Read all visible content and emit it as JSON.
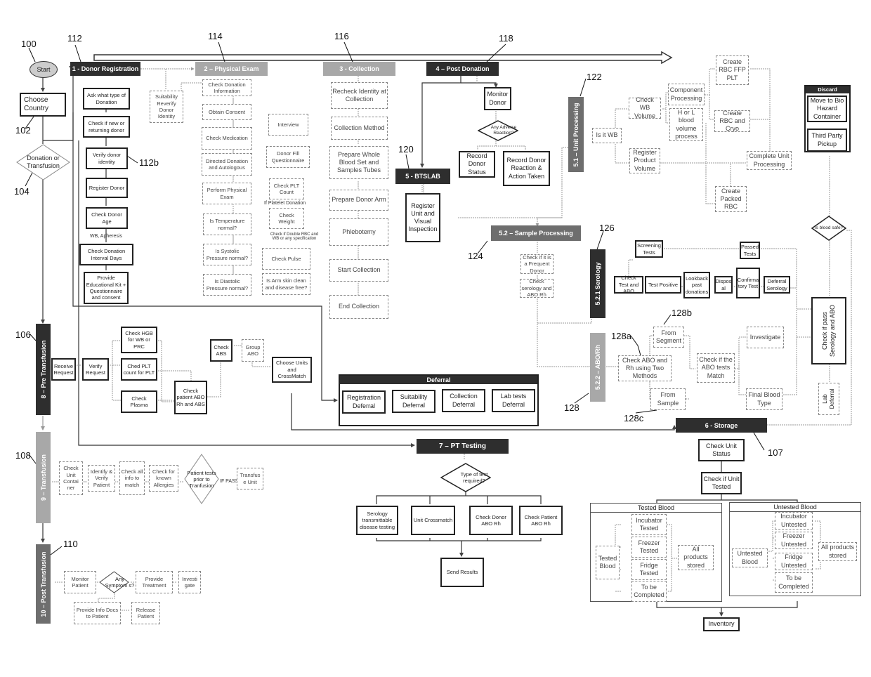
{
  "start": "Start",
  "refs": {
    "r100": "100",
    "r102": "102",
    "r104": "104",
    "r106": "106",
    "r107": "107",
    "r108": "108",
    "r110": "110",
    "r112": "112",
    "r112b": "112b",
    "r114": "114",
    "r116": "116",
    "r118": "118",
    "r120": "120",
    "r122": "122",
    "r124": "124",
    "r126": "126",
    "r128": "128",
    "r128a": "128a",
    "r128b": "128b",
    "r128c": "128c"
  },
  "entry": {
    "choose_country": "Choose Country",
    "donation_or_transfusion": "Donation or Transfusion"
  },
  "stages": {
    "s1": "1 - Donor Registration",
    "s2": "2 – Physical Exam",
    "s3": "3 - Collection",
    "s4": "4 – Post Donation",
    "s5": "5 - BTSLAB",
    "s51": "5.1 – Unit Processing",
    "s52": "5.2 – Sample Processing",
    "s521": "5.2.1 Serology",
    "s522": "5.2.2 – ABO/Rh",
    "s6": "6 - Storage",
    "s7": "7 – PT Testing",
    "s8": "8 – Pre Transfusion",
    "s9": "9 – Transfusion",
    "s10": "10 – Post Transfusion"
  },
  "registration": [
    "Ask what type of Donation",
    "Check if new or returning donor",
    "Verify donor identity",
    "Register Donor",
    "Check Donor Age",
    "Check Donation Interval Days",
    "Provide Educational Kit + Questionnaire and consent"
  ],
  "registration_label_wb": "WB, Apheresis",
  "suitability": "Suitability Reverify Donor Identity",
  "physical": [
    "Check Donation Information",
    "Obtain Consent",
    "Check Medication",
    "Directed Donation and Autologous",
    "Perform Physical Exam",
    "Is Temperature normal?",
    "Is Systolic Pressure normal?",
    "Is Diastolic Pressure normal?"
  ],
  "physical_side": [
    "Interview",
    "Donor Fill Questionnaire",
    "Check PLT Count",
    "Check Weight",
    "Check Pulse",
    "Is Arm skin clean and disease free?"
  ],
  "physical_labels": {
    "platelet": "If Platelet Donation",
    "double": "Check if Double RBC and WB or any specification"
  },
  "collection": [
    "Recheck Identity at Collection",
    "Collection Method",
    "Prepare Whole Blood Set and Samples Tubes",
    "Prepare Donor Arm",
    "Phlebotemy",
    "Start Collection",
    "End Collection"
  ],
  "post_donation": {
    "monitor": "Monitor Donor",
    "adverse": "Any Adverse Reaction?",
    "status": "Record Donor Status",
    "reaction": "Record Donor Reaction & Action Taken"
  },
  "btslab": {
    "register": "Register Unit and Visual Inspection"
  },
  "unit_processing": {
    "is_wb": "Is it WB",
    "check_wb": "Check WB Volume",
    "register_product": "Register Product Volume",
    "component": "Component Processing",
    "hl": "H or L blood volume process",
    "rbc_ffp": "Create RBC FFP PLT",
    "rbc_cryo": "Create RBC and Cryo",
    "packed": "Create Packed RBC",
    "complete": "Complete Unit Processing"
  },
  "sample_processing": {
    "frequent": "Check if it is a Frequent Donor",
    "serology_abo": "Check serology and ABO Rh"
  },
  "serology": {
    "check_test": "Check Test and ABO",
    "screening": "Screening Tests",
    "positive": "Test Positive",
    "lookback": "Lookback past donations",
    "disposal": "Dispos al",
    "confirmatory": "Confirma tory Test",
    "deferral": "Deferral Serology",
    "passed": "Passed Tests"
  },
  "abo": {
    "check_two": "Check ABO and Rh using Two Methods",
    "segment": "From Segment",
    "sample": "From Sample",
    "match": "Check if the ABO tests Match",
    "investigate": "Investigate",
    "final": "Final Blood Type"
  },
  "final_check": {
    "pass": "Check if pass Serology and ABO",
    "safe": "Is blood safe?",
    "lab_deferral": "Lab Deferral"
  },
  "discard": {
    "title": "Discard",
    "bio": "Move to Bio Hazard Container",
    "third": "Third Party Pickup"
  },
  "deferral": {
    "title": "Deferral",
    "items": [
      "Registration Deferral",
      "Suitability Deferral",
      "Collection Deferral",
      "Lab tests Deferral"
    ]
  },
  "pre_transfusion": {
    "receive": "Receive Request",
    "verify": "Verify Request",
    "hgb": "Check HGB for WB or PRC",
    "plt": "Ched PLT count for PLT",
    "plasma": "Check Plasma",
    "patient_abo": "Check patient ABO Rh and ABS",
    "abs": "Check ABS",
    "group": "Group ABO",
    "choose": "Choose Units and CrossMatch"
  },
  "transfusion": {
    "container": "Check Unit Contai ner",
    "identify": "Identify & Verify Patient",
    "info": "Check all info to match",
    "allergies": "Check for known Allergies",
    "tests": "Patient tests prior to Tranfusion",
    "if_pass": "IF PASS",
    "unit": "Transfus e Unit"
  },
  "post_transfusion": {
    "monitor": "Monitor Patient",
    "symptoms": "Any Symptom s?",
    "treatment": "Provide Treatment",
    "investigate": "Investi gate",
    "info_docs": "Provide Info Docs to Patient",
    "release": "Release Patient"
  },
  "pt_testing": {
    "type": "Type of test required?",
    "serology": "Serology transmittable disease testing",
    "crossmatch": "Unit Crossmatch",
    "donor": "Check Donor ABO Rh",
    "patient": "Check Patient ABO Rh",
    "send": "Send Results"
  },
  "storage": {
    "status": "Check Unit Status",
    "tested_check": "Check if Unit Tested",
    "tested_title": "Tested Blood",
    "untested_title": "Untested Blood",
    "tested_blood": "Tested Blood",
    "untested_blood": "Untested Blood",
    "tested_items": [
      "Incubator Tested",
      "Freezer Tested",
      "Fridge Tested",
      "To be Completed"
    ],
    "untested_items": [
      "Incubator Untested",
      "Freezer Untested",
      "Fridge Untested",
      "To be Completed"
    ],
    "all_stored": "All products stored",
    "all_stored_u": "All products stored",
    "inventory": "Inventory"
  }
}
